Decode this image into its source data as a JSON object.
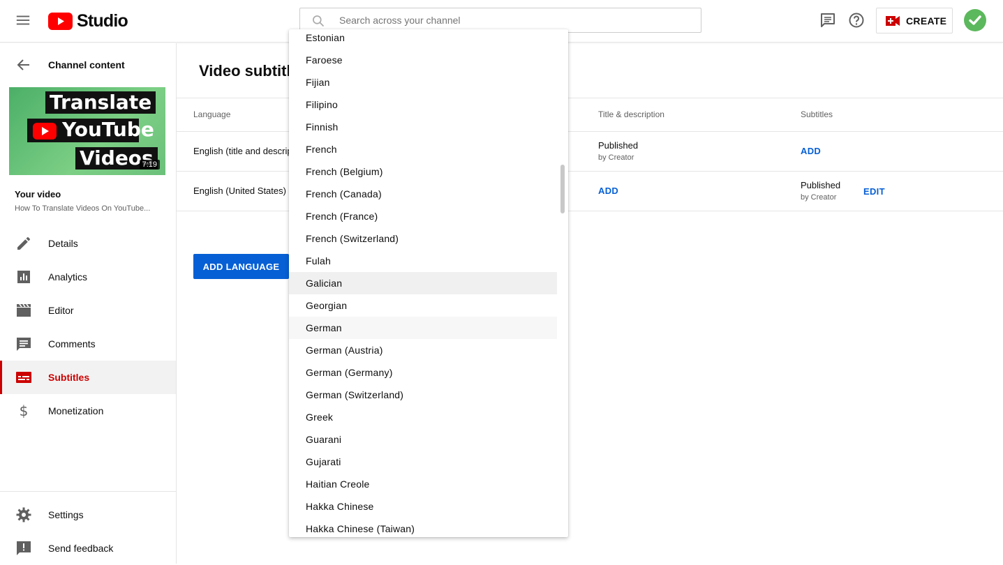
{
  "header": {
    "logo_text": "Studio",
    "search_placeholder": "Search across your channel",
    "create_label": "CREATE",
    "accent_color": "#ff0000"
  },
  "sidebar": {
    "back_label": "Channel content",
    "thumbnail": {
      "lines": [
        "Translate",
        "YouTube",
        "Videos"
      ],
      "duration": "7:19"
    },
    "your_video_label": "Your video",
    "video_title": "How To Translate Videos On YouTube...",
    "items": [
      {
        "label": "Details",
        "icon": "pencil-icon"
      },
      {
        "label": "Analytics",
        "icon": "analytics-icon"
      },
      {
        "label": "Editor",
        "icon": "clapperboard-icon"
      },
      {
        "label": "Comments",
        "icon": "comment-icon"
      },
      {
        "label": "Subtitles",
        "icon": "subtitles-icon",
        "active": true
      },
      {
        "label": "Monetization",
        "icon": "dollar-icon"
      }
    ],
    "bottom_items": [
      {
        "label": "Settings",
        "icon": "gear-icon"
      },
      {
        "label": "Send feedback",
        "icon": "feedback-icon"
      }
    ],
    "active_color": "#cc0000"
  },
  "main": {
    "page_title": "Video subtitl",
    "columns": {
      "language": "Language",
      "title_description": "Title & description",
      "subtitles": "Subtitles"
    },
    "rows": [
      {
        "language": "English (title and descrip",
        "title_status": "Published",
        "title_by": "by Creator",
        "subtitles_action": "ADD"
      },
      {
        "language": "English (United States) (",
        "title_action": "ADD",
        "subtitles_status": "Published",
        "subtitles_by": "by Creator",
        "subtitles_edit": "EDIT"
      }
    ],
    "add_language_label": "ADD LANGUAGE",
    "link_color": "#065fd4"
  },
  "dropdown": {
    "options": [
      "Estonian",
      "Faroese",
      "Fijian",
      "Filipino",
      "Finnish",
      "French",
      "French (Belgium)",
      "French (Canada)",
      "French (France)",
      "French (Switzerland)",
      "Fulah",
      "Galician",
      "Georgian",
      "German",
      "German (Austria)",
      "German (Germany)",
      "German (Switzerland)",
      "Greek",
      "Guarani",
      "Gujarati",
      "Haitian Creole",
      "Hakka Chinese",
      "Hakka Chinese (Taiwan)"
    ],
    "hovered": "Galician",
    "focused": "German"
  }
}
